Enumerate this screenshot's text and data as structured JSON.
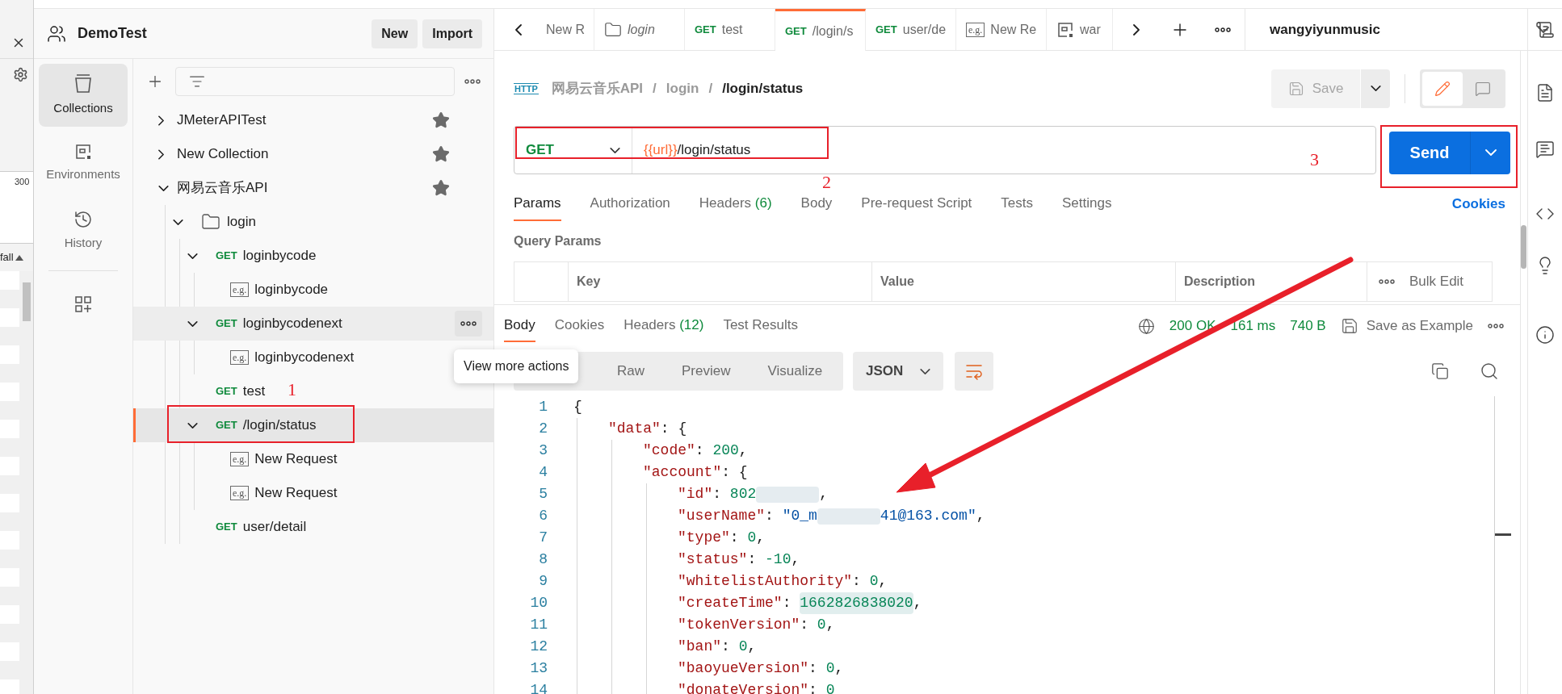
{
  "background_window": {
    "reading": "300",
    "column_label": "fall"
  },
  "workspace": {
    "name": "DemoTest",
    "buttons": [
      "New",
      "Import"
    ]
  },
  "nav": [
    {
      "kind": "collections",
      "label": "Collections",
      "selected": true
    },
    {
      "kind": "environments",
      "label": "Environments",
      "selected": false
    },
    {
      "kind": "history",
      "label": "History",
      "selected": false
    }
  ],
  "tree": {
    "tooltip": "View more actions",
    "items": [
      {
        "kind": "collection",
        "name": "JMeterAPITest",
        "expanded": false,
        "starred": true,
        "selected": false,
        "hovered": false
      },
      {
        "kind": "collection",
        "name": "New Collection",
        "expanded": false,
        "starred": true,
        "selected": false,
        "hovered": false
      },
      {
        "kind": "collection",
        "name": "网易云音乐API",
        "expanded": true,
        "starred": true,
        "selected": false,
        "hovered": false,
        "children": [
          {
            "kind": "folder",
            "name": "login",
            "expanded": true,
            "selected": false,
            "hovered": false,
            "children": [
              {
                "kind": "request",
                "method": "GET",
                "name": "loginbycode",
                "expanded": true,
                "selected": false,
                "hovered": false,
                "children": [
                  {
                    "kind": "example",
                    "badge": "e.g.",
                    "name": "loginbycode",
                    "selected": false,
                    "hovered": false
                  }
                ]
              },
              {
                "kind": "request",
                "method": "GET",
                "name": "loginbycodenext",
                "expanded": true,
                "selected": false,
                "hovered": true,
                "children": [
                  {
                    "kind": "example",
                    "badge": "e.g.",
                    "name": "loginbycodenext",
                    "selected": false,
                    "hovered": false
                  }
                ]
              },
              {
                "kind": "request",
                "method": "GET",
                "name": "test",
                "selected": false,
                "hovered": false
              },
              {
                "kind": "request",
                "method": "GET",
                "name": "/login/status",
                "expanded": true,
                "selected": true,
                "hovered": false,
                "children": [
                  {
                    "kind": "example",
                    "badge": "e.g.",
                    "name": "New Request",
                    "selected": false,
                    "hovered": false
                  },
                  {
                    "kind": "example",
                    "badge": "e.g.",
                    "name": "New Request",
                    "selected": false,
                    "hovered": false
                  }
                ]
              },
              {
                "kind": "request",
                "method": "GET",
                "name": "user/detail",
                "selected": false,
                "hovered": false
              }
            ]
          }
        ]
      }
    ]
  },
  "tabs": [
    {
      "kind": "text",
      "label": "New R",
      "selected": false,
      "preview": false
    },
    {
      "kind": "folder",
      "label": "login",
      "selected": false,
      "preview": true
    },
    {
      "kind": "request",
      "method": "GET",
      "label": "test",
      "selected": false,
      "preview": false
    },
    {
      "kind": "request",
      "method": "GET",
      "label": "/login/s",
      "selected": true,
      "preview": false
    },
    {
      "kind": "request",
      "method": "GET",
      "label": "user/de",
      "selected": false,
      "preview": false
    },
    {
      "kind": "example",
      "badge": "e.g.",
      "label": "New Re",
      "selected": false,
      "preview": false
    },
    {
      "kind": "environment",
      "label": "war",
      "selected": false,
      "preview": false
    }
  ],
  "environment": {
    "name": "wangyiyunmusic"
  },
  "request": {
    "badge": "HTTP",
    "breadcrumb": [
      "网易云音乐API",
      "login",
      "/login/status"
    ],
    "breadcrumb_separator": "/",
    "save_label": "Save",
    "modes": [
      {
        "kind": "edit",
        "selected": true
      },
      {
        "kind": "comments",
        "selected": false
      }
    ],
    "method": "GET",
    "url_variable": "{{url}}",
    "url_path": "/login/status",
    "send_label": "Send",
    "tabs": [
      {
        "label": "Params",
        "selected": true
      },
      {
        "label": "Authorization",
        "selected": false
      },
      {
        "label": "Headers",
        "count": "(6)",
        "selected": false
      },
      {
        "label": "Body",
        "selected": false
      },
      {
        "label": "Pre-request Script",
        "selected": false
      },
      {
        "label": "Tests",
        "selected": false
      },
      {
        "label": "Settings",
        "selected": false
      }
    ],
    "cookies_link": "Cookies",
    "section_title": "Query Params",
    "columns": [
      "Key",
      "Value",
      "Description"
    ],
    "bulk_edit": "Bulk Edit"
  },
  "response": {
    "tabs": [
      {
        "label": "Body",
        "selected": true
      },
      {
        "label": "Cookies",
        "selected": false
      },
      {
        "label": "Headers",
        "count": "(12)",
        "selected": false
      },
      {
        "label": "Test Results",
        "selected": false
      }
    ],
    "status": "200 OK",
    "time": "161 ms",
    "size": "740 B",
    "save_example": "Save as Example",
    "formats": [
      {
        "label": "Raw",
        "selected": false
      },
      {
        "label": "Preview",
        "selected": false
      },
      {
        "label": "Visualize",
        "selected": false
      }
    ],
    "language": "JSON",
    "lines": [
      {
        "num": "1",
        "tokens": [
          {
            "kind": "punct",
            "text": "{"
          }
        ],
        "children": [
          {
            "num": "2",
            "tokens": [
              {
                "kind": "key",
                "text": "\"data\""
              },
              {
                "kind": "punct",
                "text": ": {"
              }
            ],
            "children": [
              {
                "num": "3",
                "tokens": [
                  {
                    "kind": "key",
                    "text": "\"code\""
                  },
                  {
                    "kind": "punct",
                    "text": ": "
                  },
                  {
                    "kind": "number",
                    "text": "200"
                  },
                  {
                    "kind": "punct",
                    "text": ","
                  }
                ]
              },
              {
                "num": "4",
                "tokens": [
                  {
                    "kind": "key",
                    "text": "\"account\""
                  },
                  {
                    "kind": "punct",
                    "text": ": {"
                  }
                ],
                "children": [
                  {
                    "num": "5",
                    "tokens": [
                      {
                        "kind": "key",
                        "text": "\"id\""
                      },
                      {
                        "kind": "punct",
                        "text": ": "
                      },
                      {
                        "kind": "number",
                        "text": "802"
                      },
                      {
                        "kind": "redacted"
                      },
                      {
                        "kind": "punct",
                        "text": ","
                      }
                    ]
                  },
                  {
                    "num": "6",
                    "tokens": [
                      {
                        "kind": "key",
                        "text": "\"userName\""
                      },
                      {
                        "kind": "punct",
                        "text": ": "
                      },
                      {
                        "kind": "string",
                        "text": "\"0_m"
                      },
                      {
                        "kind": "redacted"
                      },
                      {
                        "kind": "string",
                        "text": "41@163.com\""
                      },
                      {
                        "kind": "punct",
                        "text": ","
                      }
                    ]
                  },
                  {
                    "num": "7",
                    "tokens": [
                      {
                        "kind": "key",
                        "text": "\"type\""
                      },
                      {
                        "kind": "punct",
                        "text": ": "
                      },
                      {
                        "kind": "number",
                        "text": "0"
                      },
                      {
                        "kind": "punct",
                        "text": ","
                      }
                    ]
                  },
                  {
                    "num": "8",
                    "tokens": [
                      {
                        "kind": "key",
                        "text": "\"status\""
                      },
                      {
                        "kind": "punct",
                        "text": ": "
                      },
                      {
                        "kind": "number",
                        "text": "-10"
                      },
                      {
                        "kind": "punct",
                        "text": ","
                      }
                    ]
                  },
                  {
                    "num": "9",
                    "tokens": [
                      {
                        "kind": "key",
                        "text": "\"whitelistAuthority\""
                      },
                      {
                        "kind": "punct",
                        "text": ": "
                      },
                      {
                        "kind": "number",
                        "text": "0"
                      },
                      {
                        "kind": "punct",
                        "text": ","
                      }
                    ]
                  },
                  {
                    "num": "10",
                    "tokens": [
                      {
                        "kind": "key",
                        "text": "\"createTime\""
                      },
                      {
                        "kind": "punct",
                        "text": ": "
                      },
                      {
                        "kind": "match",
                        "text": "1662826838020"
                      },
                      {
                        "kind": "punct",
                        "text": ","
                      }
                    ]
                  },
                  {
                    "num": "11",
                    "tokens": [
                      {
                        "kind": "key",
                        "text": "\"tokenVersion\""
                      },
                      {
                        "kind": "punct",
                        "text": ": "
                      },
                      {
                        "kind": "number",
                        "text": "0"
                      },
                      {
                        "kind": "punct",
                        "text": ","
                      }
                    ]
                  },
                  {
                    "num": "12",
                    "tokens": [
                      {
                        "kind": "key",
                        "text": "\"ban\""
                      },
                      {
                        "kind": "punct",
                        "text": ": "
                      },
                      {
                        "kind": "number",
                        "text": "0"
                      },
                      {
                        "kind": "punct",
                        "text": ","
                      }
                    ]
                  },
                  {
                    "num": "13",
                    "tokens": [
                      {
                        "kind": "key",
                        "text": "\"baoyueVersion\""
                      },
                      {
                        "kind": "punct",
                        "text": ": "
                      },
                      {
                        "kind": "number",
                        "text": "0"
                      },
                      {
                        "kind": "punct",
                        "text": ","
                      }
                    ]
                  },
                  {
                    "num": "14",
                    "tokens": [
                      {
                        "kind": "key",
                        "text": "\"donateVersion\""
                      },
                      {
                        "kind": "punct",
                        "text": ": "
                      },
                      {
                        "kind": "number",
                        "text": "0"
                      }
                    ]
                  }
                ]
              }
            ]
          }
        ]
      }
    ]
  },
  "annotations": [
    {
      "label": "1"
    },
    {
      "label": "2"
    },
    {
      "label": "3"
    }
  ]
}
